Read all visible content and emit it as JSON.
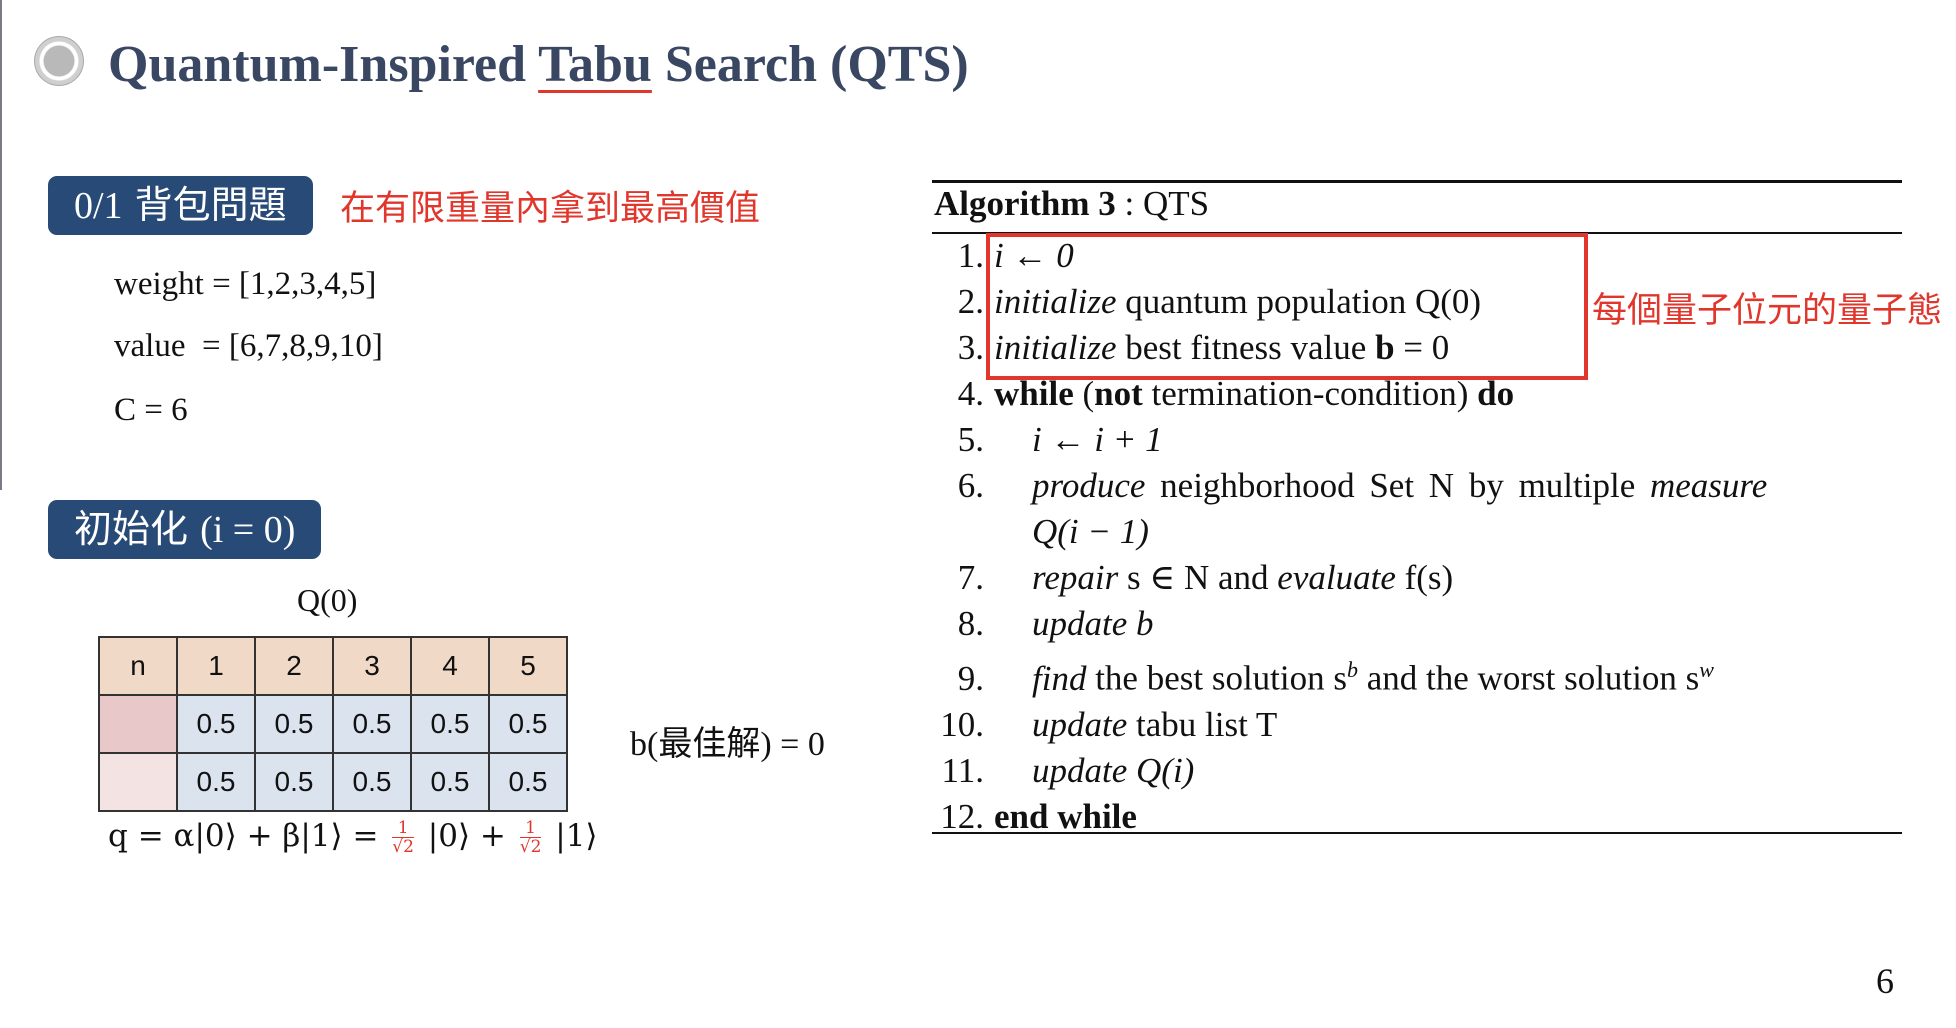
{
  "title": {
    "before": "Quantum-Inspired ",
    "underlined": "Tabu",
    "after": " Search (QTS)"
  },
  "knapsack": {
    "label_num": "0/1",
    "label_text": " 背包問題",
    "note": "在有限重量內拿到最高價值",
    "weight": "weight = [1,2,3,4,5]",
    "value": "value  = [6,7,8,9,10]",
    "capacity": "C = 6"
  },
  "init": {
    "label_text": "初始化 ",
    "label_num": "(i = 0)",
    "table_caption": "Q(0)",
    "header": [
      "n",
      "1",
      "2",
      "3",
      "4",
      "5"
    ],
    "row_alpha": [
      "",
      "0.5",
      "0.5",
      "0.5",
      "0.5",
      "0.5"
    ],
    "row_beta": [
      "",
      "0.5",
      "0.5",
      "0.5",
      "0.5",
      "0.5"
    ],
    "formula_lhs": "q = α|0⟩ + β|1⟩ = ",
    "frac_num": "1",
    "frac_den": "√2",
    "ket0": " |0⟩ + ",
    "ket1": " |1⟩",
    "best": "b(最佳解) = 0"
  },
  "algorithm": {
    "title_bold": "Algorithm 3",
    "title_rest": " : QTS",
    "note": "每個量子位元的量子態",
    "lines": [
      {
        "n": "1.",
        "t": "i ← 0"
      },
      {
        "n": "2.",
        "a": "initialize",
        "t": " quantum population Q(0)"
      },
      {
        "n": "3.",
        "a": "initialize",
        "t": " best fitness value ",
        "b": "b",
        "t2": " = 0"
      },
      {
        "n": "4.",
        "b": "while",
        "t": " (",
        "b2": "not",
        "t2": " termination-condition) ",
        "b3": "do"
      },
      {
        "n": "5.",
        "t": "i ← i + 1"
      },
      {
        "n": "6.",
        "a": "produce",
        "t": " neighborhood Set N by multiple ",
        "a2": "measure"
      },
      {
        "n": "",
        "t": "Q(i − 1)"
      },
      {
        "n": "7.",
        "a": "repair",
        "t": " s ∈ N and ",
        "a2": "evaluate",
        "t2": " f(s)"
      },
      {
        "n": "8.",
        "a": "update",
        "t": " b"
      },
      {
        "n": "9.",
        "a": "find",
        "t": " the best solution s",
        "sup": "b",
        "t2": " and the worst solution s",
        "sup2": "w"
      },
      {
        "n": "10.",
        "a": "update",
        "t": " tabu list T"
      },
      {
        "n": "11.",
        "a": "update",
        "t": " Q(i)"
      },
      {
        "n": "12.",
        "b": "end while"
      }
    ]
  },
  "page_number": "6"
}
